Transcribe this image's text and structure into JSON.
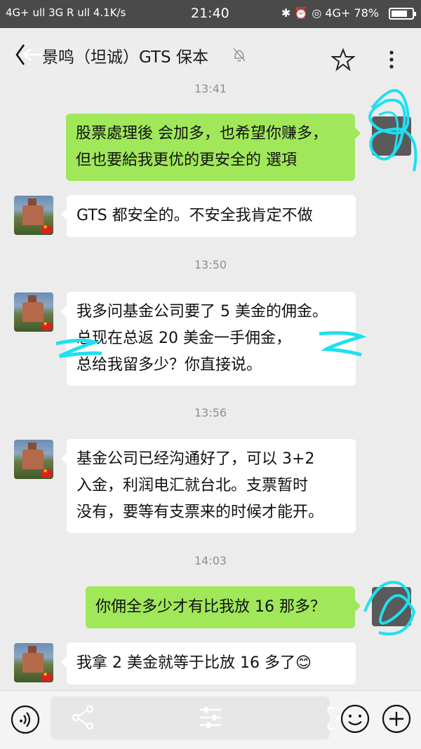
{
  "status_bar": {
    "left": "4G+ ull 3G R ull 4.1K/s",
    "time": "21:40",
    "right": "✱ ⏰ ◎ 4G+ 78%",
    "battery_level": 0.78
  },
  "header": {
    "title": "景鸣（坦诚）GTS 保本",
    "back_icon": "back-arrow-icon",
    "mute_icon": "bell-muted-icon",
    "star_icon": "star-icon",
    "more_icon": "more-vertical-icon"
  },
  "messages": [
    {
      "type": "time",
      "text": "13:41"
    },
    {
      "type": "out",
      "lines": [
        "股票處理後 会加多，也希望你赚多，",
        "但也要給我更优的更安全的 選項"
      ]
    },
    {
      "type": "in",
      "lines": [
        "GTS 都安全的。不安全我肯定不做"
      ]
    },
    {
      "type": "time",
      "text": "13:50"
    },
    {
      "type": "in",
      "lines": [
        "我多问基金公司要了 5 美金的佣金。",
        "总现在总返 20 美金一手佣金，",
        "总给我留多少？你直接说。"
      ]
    },
    {
      "type": "time",
      "text": "13:56"
    },
    {
      "type": "in",
      "lines": [
        "基金公司已经沟通好了，可以 3+2",
        "入金，利润电汇就台北。支票暂时",
        "没有，要等有支票来的时候才能开。"
      ]
    },
    {
      "type": "time",
      "text": "14:03"
    },
    {
      "type": "out",
      "lines": [
        "你佣全多少才有比我放 16 那多？"
      ]
    },
    {
      "type": "in",
      "lines": [
        "我拿 2 美金就等于比放 16 多了😊"
      ]
    }
  ],
  "toolbar": {
    "voice_icon": "voice-icon",
    "share_icon": "share-icon",
    "settings_icon": "sliders-icon",
    "scan_icon": "scan-icon",
    "emoji_icon": "emoji-icon",
    "add_icon": "plus-icon"
  },
  "colors": {
    "outgoing_bubble": "#a0e75a",
    "incoming_bubble": "#ffffff",
    "background": "#ececec",
    "scribble": "#1ee0f0"
  }
}
